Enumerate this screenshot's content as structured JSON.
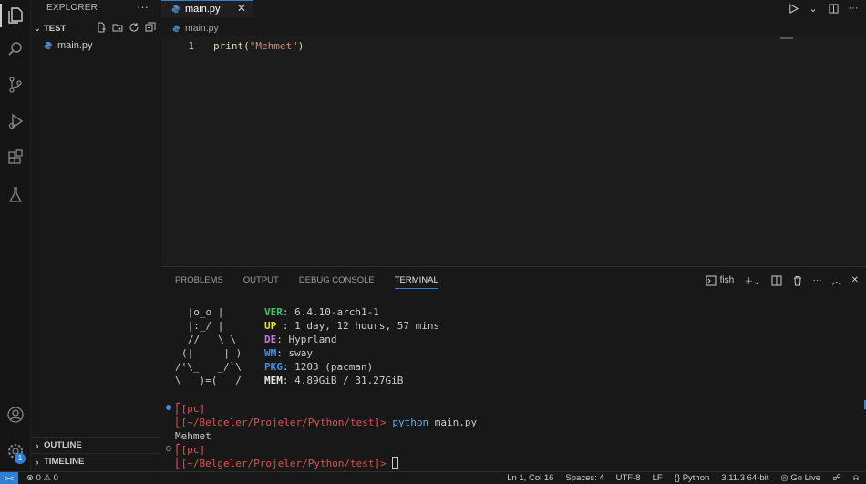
{
  "sidebar": {
    "title": "EXPLORER",
    "more": "···",
    "folder": "TEST",
    "file": "main.py",
    "outline": "OUTLINE",
    "timeline": "TIMELINE"
  },
  "editor": {
    "tab_label": "main.py",
    "breadcrumb": "main.py",
    "line_number": "1",
    "code_func": "print(",
    "code_string": "\"Mehmet\"",
    "code_close": ")"
  },
  "panel": {
    "tabs": [
      "PROBLEMS",
      "OUTPUT",
      "DEBUG CONSOLE",
      "TERMINAL"
    ],
    "shell": "fish"
  },
  "terminal": {
    "art": [
      " |o_o |",
      " |:_/ |",
      "//   \\ \\",
      "(|     | )",
      "/'\\_   _/`\\",
      "\\___)=(___/"
    ],
    "info": [
      {
        "key": "VER",
        "sep": ": ",
        "value": "6.4.10-arch1-1"
      },
      {
        "key": "UP",
        "sep": " : ",
        "value": "1 day, 12 hours, 57 mins"
      },
      {
        "key": "DE",
        "sep": ": ",
        "value": "Hyprland"
      },
      {
        "key": "WM",
        "sep": ": ",
        "value": "sway"
      },
      {
        "key": "PKG",
        "sep": ": ",
        "value": "1203 (pacman)"
      },
      {
        "key": "MEM",
        "sep": ": ",
        "value": "4.89GiB / 31.27GiB"
      }
    ],
    "host": "[pc]",
    "path": "[~/Belgeler/Projeler/Python/test]",
    "prompt_char": ">",
    "command": "python",
    "command_arg": "main.py",
    "output": "Mehmet"
  },
  "status": {
    "remote": "><",
    "problems": "⊗ 0 ⚠ 0",
    "position": "Ln 1, Col 16",
    "spaces": "Spaces: 4",
    "encoding": "UTF-8",
    "eol": "LF",
    "language": "Python",
    "interpreter": "3.11.3 64-bit",
    "golive": "Go Live"
  },
  "colors": {
    "accent": "#2f7fd6",
    "background": "#181818"
  }
}
